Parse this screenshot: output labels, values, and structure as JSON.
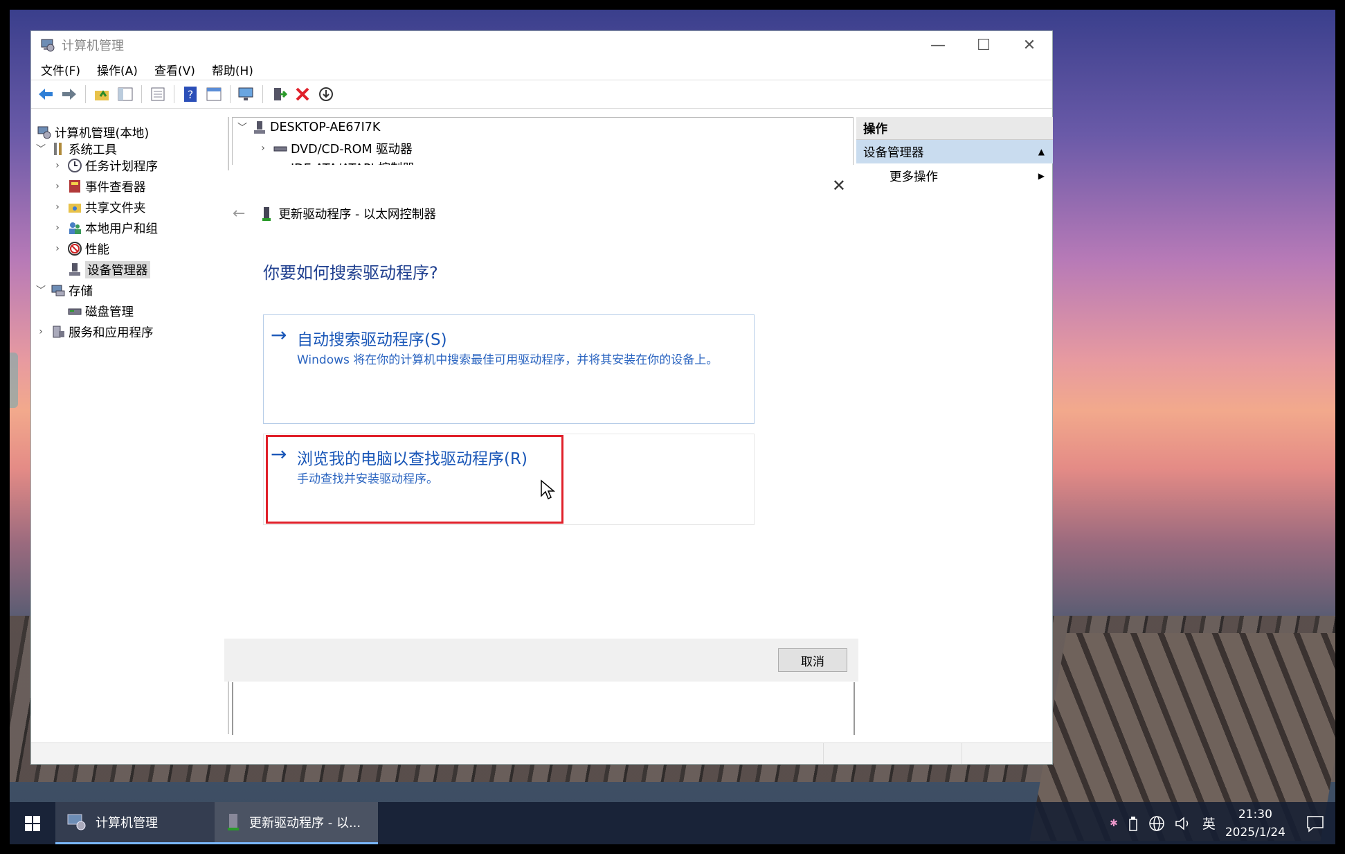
{
  "window": {
    "title": "计算机管理",
    "controls": {
      "minimize": "—",
      "maximize": "☐",
      "close": "✕"
    },
    "menu": [
      "文件(F)",
      "操作(A)",
      "查看(V)",
      "帮助(H)"
    ]
  },
  "tree": {
    "root": "计算机管理(本地)",
    "system_tools": "系统工具",
    "items": [
      "任务计划程序",
      "事件查看器",
      "共享文件夹",
      "本地用户和组",
      "性能",
      "设备管理器"
    ],
    "storage": "存储",
    "disk": "磁盘管理",
    "services": "服务和应用程序"
  },
  "devices": {
    "computer": "DESKTOP-AE67I7K",
    "dvd": "DVD/CD-ROM 驱动器",
    "ide": "IDE ATA/ATAPI 控制器"
  },
  "actions": {
    "header": "操作",
    "section": "设备管理器",
    "more": "更多操作"
  },
  "dialog": {
    "breadcrumb": "更新驱动程序 - 以太网控制器",
    "question": "你要如何搜索驱动程序?",
    "option1": {
      "title": "自动搜索驱动程序(S)",
      "desc": "Windows 将在你的计算机中搜索最佳可用驱动程序，并将其安装在你的设备上。"
    },
    "option2": {
      "title": "浏览我的电脑以查找驱动程序(R)",
      "desc": "手动查找并安装驱动程序。"
    },
    "cancel": "取消"
  },
  "taskbar": {
    "app1": "计算机管理",
    "app2": "更新驱动程序 - 以...",
    "ime": "英",
    "time": "21:30",
    "date": "2025/1/24"
  }
}
